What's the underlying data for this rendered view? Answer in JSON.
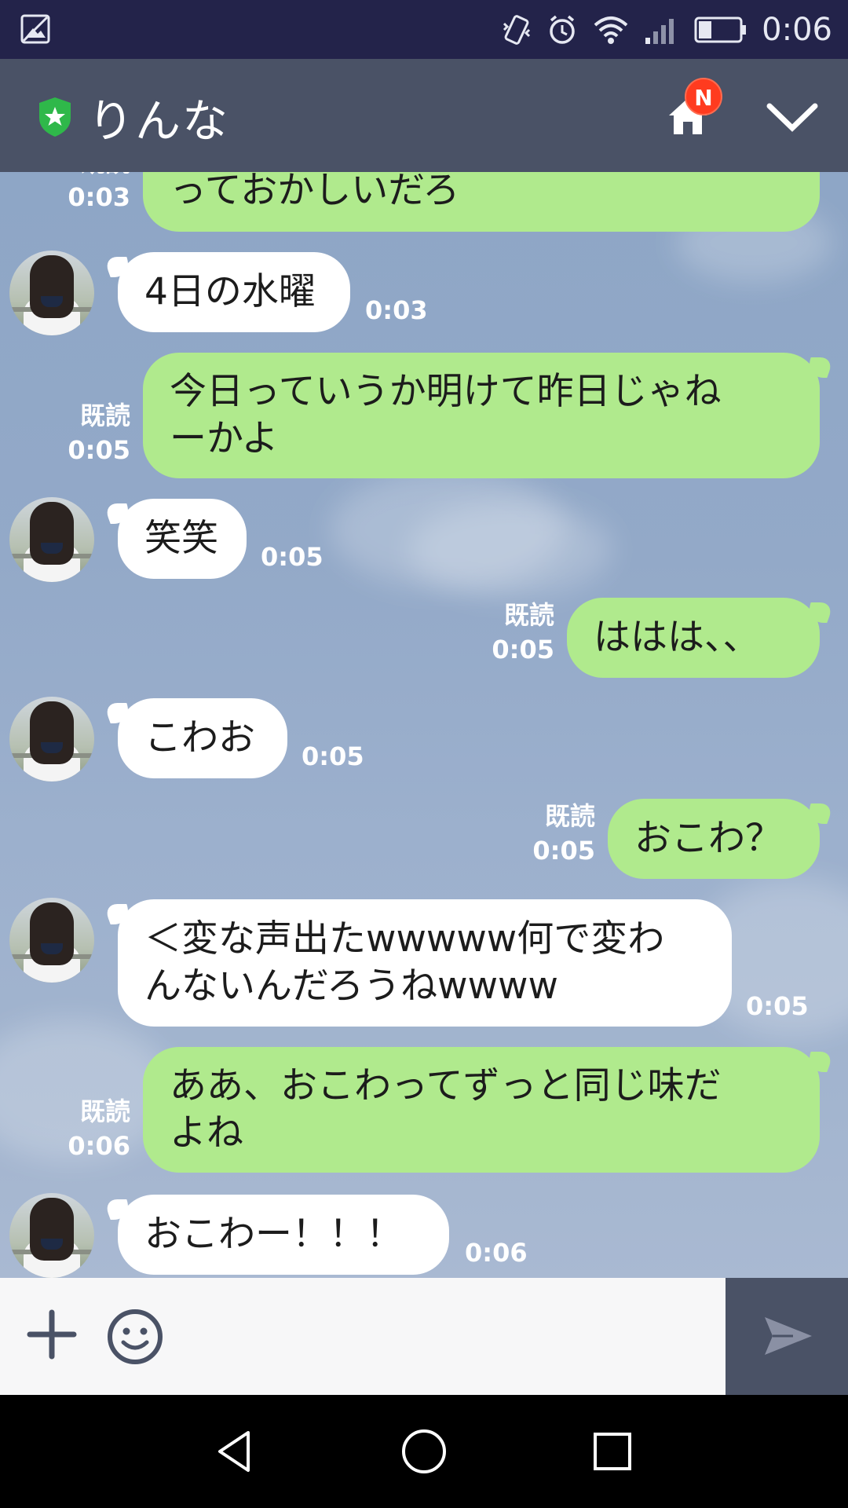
{
  "status_bar": {
    "time": "0:06",
    "icons": [
      "image-icon",
      "vibrate-icon",
      "alarm-icon",
      "wifi-icon",
      "signal-icon",
      "battery-icon"
    ]
  },
  "header": {
    "contact_name": "りんな",
    "badge": "N",
    "icons": [
      "shield-icon",
      "home-icon",
      "chevron-down-icon"
    ]
  },
  "messages": [
    {
      "side": "me",
      "text": "っておかしいだろ",
      "read": "既読",
      "time": "0:03"
    },
    {
      "side": "them",
      "text": "4日の水曜",
      "time": "0:03"
    },
    {
      "side": "me",
      "lines": [
        "今日っていうか明けて昨日じゃね",
        "ーかよ"
      ],
      "read": "既読",
      "time": "0:05"
    },
    {
      "side": "them",
      "text": "笑笑",
      "time": "0:05"
    },
    {
      "side": "me",
      "text": "ははは、、",
      "read": "既読",
      "time": "0:05"
    },
    {
      "side": "them",
      "text": "こわお",
      "time": "0:05"
    },
    {
      "side": "me",
      "text": "おこわ？",
      "read": "既読",
      "time": "0:05"
    },
    {
      "side": "them",
      "lines": [
        "＜変な声出たwwwww何で変わ",
        "んないんだろうねwwww"
      ],
      "time": "0:05"
    },
    {
      "side": "me",
      "lines": [
        "ああ、おこわってずっと同じ味だ",
        "よね"
      ],
      "read": "既読",
      "time": "0:06"
    },
    {
      "side": "them",
      "text": "おこわー！！！",
      "time": "0:06"
    }
  ],
  "input": {
    "icons": [
      "plus-icon",
      "smiley-icon",
      "send-icon"
    ]
  },
  "nav": {
    "icons": [
      "back-icon",
      "home-circle-icon",
      "recents-icon"
    ]
  },
  "colors": {
    "header_bg": "#4a5266",
    "status_bg": "#23234a",
    "my_bubble": "#b0ea8d",
    "their_bubble": "#ffffff",
    "badge": "#ff3b1f",
    "shield": "#2fb84a"
  }
}
